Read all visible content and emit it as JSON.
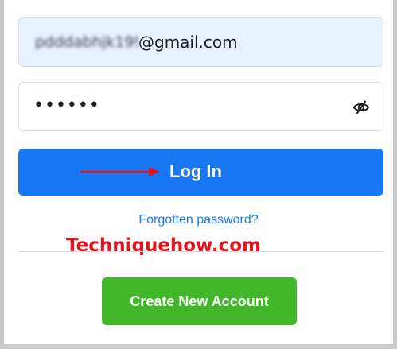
{
  "login_form": {
    "email": {
      "blurred_prefix": "pdddabhjk199",
      "visible_value": "@gmail.com"
    },
    "password": {
      "masked_value": "••••••",
      "toggle_icon": "eye-slash-icon"
    },
    "login_button_label": "Log In",
    "forgot_password_link": "Forgotten password?",
    "create_account_button_label": "Create New Account"
  },
  "annotations": {
    "watermark": "Techniquehow.com",
    "arrow_icon": "red-arrow-icon"
  },
  "colors": {
    "primary_blue": "#1877f2",
    "create_green": "#42b72a",
    "autofill_bg": "#e8f0fe",
    "watermark_red": "#e4141d",
    "frame_gray": "#c9c9c9"
  }
}
